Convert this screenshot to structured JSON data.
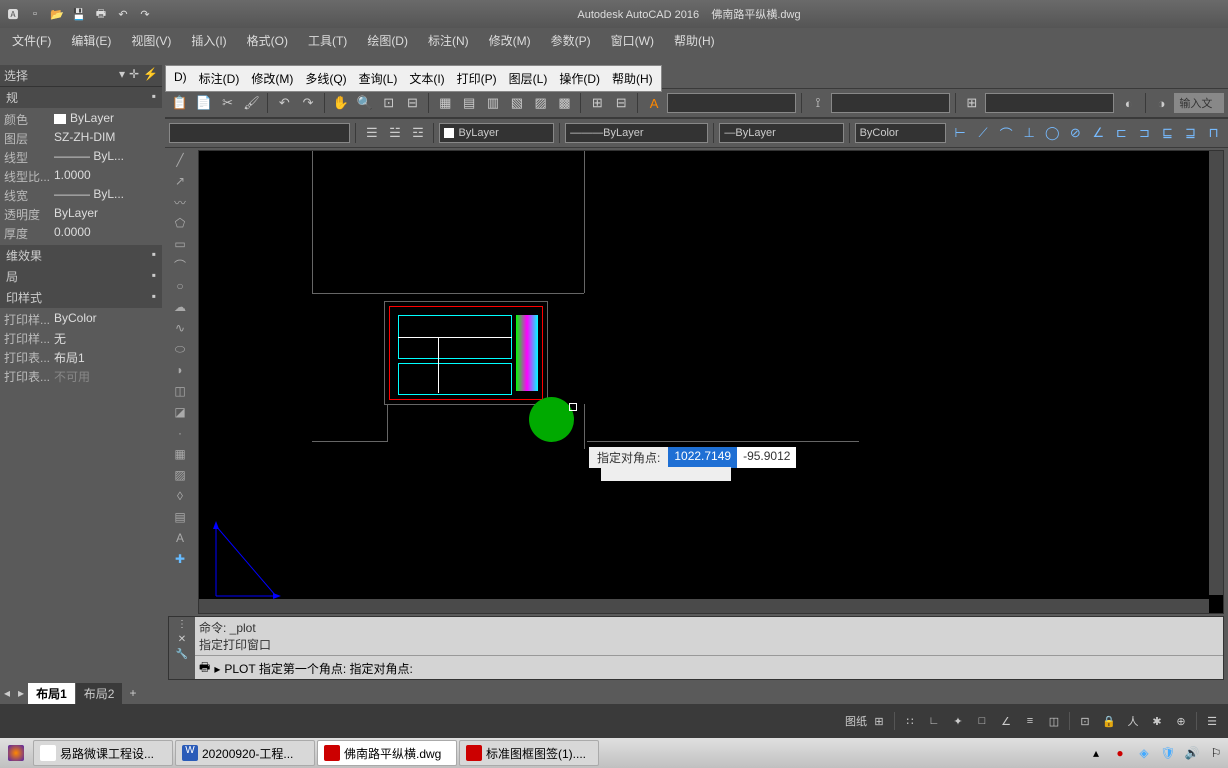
{
  "title": {
    "app": "Autodesk AutoCAD 2016",
    "doc": "佛南路平纵横.dwg"
  },
  "menu": [
    "文件(F)",
    "编辑(E)",
    "视图(V)",
    "插入(I)",
    "格式(O)",
    "工具(T)",
    "绘图(D)",
    "标注(N)",
    "修改(M)",
    "参数(P)",
    "窗口(W)",
    "帮助(H)"
  ],
  "submenu": [
    "D)",
    "标注(D)",
    "修改(M)",
    "多线(Q)",
    "查询(L)",
    "文本(I)",
    "打印(P)",
    "图层(L)",
    "操作(D)",
    "帮助(H)"
  ],
  "panel": {
    "sel_label": "选择",
    "gen_label": "规",
    "props": [
      {
        "name": "颜色",
        "val": "ByLayer",
        "sw": true
      },
      {
        "name": "图层",
        "val": "SZ-ZH-DIM"
      },
      {
        "name": "线型",
        "val": "——— ByL..."
      },
      {
        "name": "线型比...",
        "val": "1.0000"
      },
      {
        "name": "线宽",
        "val": "——— ByL..."
      },
      {
        "name": "透明度",
        "val": "ByLayer"
      },
      {
        "name": "厚度",
        "val": "0.0000"
      }
    ],
    "sec2": "维效果",
    "sec3": "局",
    "sec4": "印样式",
    "print_props": [
      {
        "name": "打印样...",
        "val": "ByColor"
      },
      {
        "name": "打印样...",
        "val": "无"
      },
      {
        "name": "打印表...",
        "val": "布局1"
      },
      {
        "name": "打印表...",
        "val": "不可用"
      }
    ]
  },
  "layer_dd": "ByLayer",
  "lt_dd": "ByLayer",
  "lw_dd": "ByLayer",
  "color_dd": "ByColor",
  "cmd": {
    "line1": "命令:  _plot",
    "line2": "指定打印窗口",
    "input": "PLOT 指定第一个角点: 指定对角点:",
    "input_icon": "▶"
  },
  "tooltip": {
    "label": "指定对角点: ",
    "val1": "1022.7149",
    "val2": "-95.9012"
  },
  "layouts": [
    "布局1",
    "布局2"
  ],
  "status": {
    "paper": "图纸"
  },
  "tasks": [
    "易路微课工程设...",
    "20200920-工程...",
    "佛南路平纵横.dwg",
    "标准图框图签(1)...."
  ],
  "cmdline_label": "输入文"
}
